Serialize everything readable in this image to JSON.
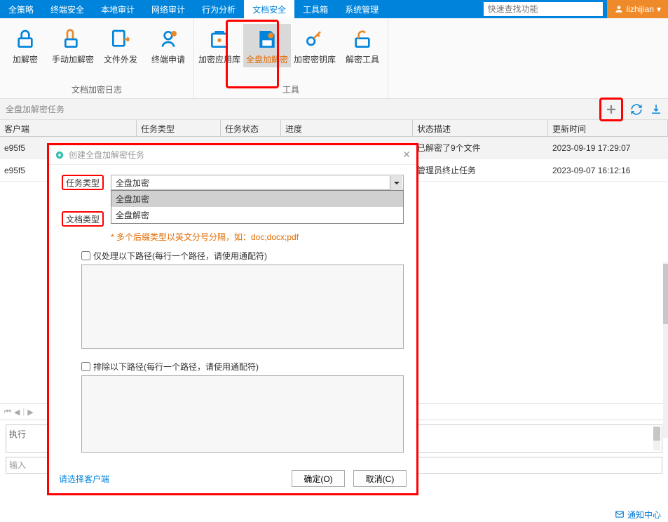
{
  "topmenu": {
    "items": [
      "全策略",
      "终端安全",
      "本地审计",
      "网络审计",
      "行为分析",
      "文档安全",
      "工具箱",
      "系统管理"
    ],
    "search_placeholder": "快速查找功能",
    "user": "lizhijian"
  },
  "ribbon": {
    "group1": {
      "label": "文档加密日志",
      "items": [
        {
          "label": "加解密",
          "icon": "lock"
        },
        {
          "label": "手动加解密",
          "icon": "hand-lock"
        },
        {
          "label": "文件外发",
          "icon": "file-send"
        },
        {
          "label": "终端申请",
          "icon": "terminal-apply"
        }
      ]
    },
    "group2": {
      "label": "工具",
      "items": [
        {
          "label": "加密应用库",
          "icon": "library"
        },
        {
          "label": "全盘加解密",
          "icon": "disk",
          "active": true
        },
        {
          "label": "加密密钥库",
          "icon": "key"
        },
        {
          "label": "解密工具",
          "icon": "unlock-tool"
        }
      ]
    }
  },
  "panel": {
    "title": "全盘加解密任务"
  },
  "grid": {
    "headers": [
      "客户端",
      "任务类型",
      "任务状态",
      "进度",
      "状态描述",
      "更新时间"
    ],
    "rows": [
      {
        "client": "e95f5",
        "desc": "已解密了9个文件",
        "time": "2023-09-19 17:29:07"
      },
      {
        "client": "e95f5",
        "desc": "管理员终止任务",
        "time": "2023-09-07 16:12:16"
      }
    ]
  },
  "bottom": {
    "result_label": "执行",
    "input_placeholder": "输入"
  },
  "footer": {
    "notify": "通知中心"
  },
  "dialog": {
    "title": "创建全盘加解密任务",
    "labels": {
      "task_type": "任务类型",
      "doc_type": "文档类型"
    },
    "select_value": "全盘加密",
    "options": [
      "全盘加密",
      "全盘解密"
    ],
    "hint": "* 多个后缀类型以英文分号分隔，如：doc;docx;pdf",
    "only_paths": "仅处理以下路径(每行一个路径，请使用通配符)",
    "exclude_paths": "排除以下路径(每行一个路径，请使用通配符)",
    "select_client": "请选择客户端",
    "ok": "确定(O)",
    "cancel": "取消(C)"
  }
}
